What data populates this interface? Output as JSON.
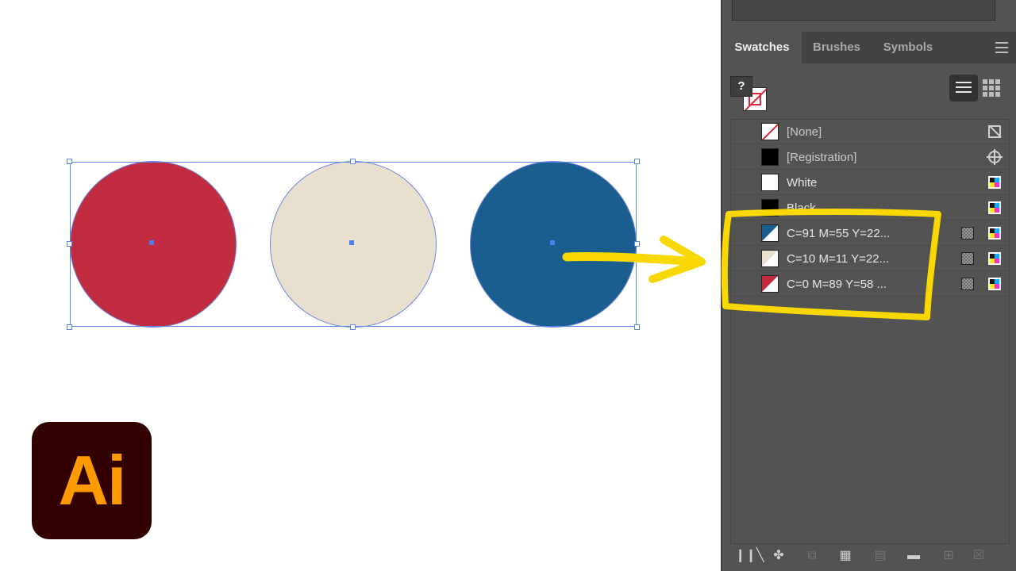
{
  "app": {
    "logo_text": "Ai",
    "logo_bg": "#330000",
    "logo_fg": "#ff9a00"
  },
  "canvas": {
    "shapes": [
      {
        "name": "red-circle",
        "color": "#c12c41"
      },
      {
        "name": "beige-circle",
        "color": "#e9dfcf"
      },
      {
        "name": "blue-circle",
        "color": "#1a5d8f"
      }
    ],
    "annotation_color": "#f8d800"
  },
  "panel": {
    "tabs": [
      {
        "label": "Swatches",
        "active": true
      },
      {
        "label": "Brushes",
        "active": false
      },
      {
        "label": "Symbols",
        "active": false
      }
    ],
    "fill_stroke": {
      "question_mark": "?"
    },
    "swatches": [
      {
        "name": "[None]",
        "type": "none",
        "mode": "nocolor"
      },
      {
        "name": "[Registration]",
        "type": "registration",
        "color": "#000000",
        "mode": "registration"
      },
      {
        "name": "White",
        "type": "process",
        "color": "#ffffff",
        "mode": "cmyk"
      },
      {
        "name": "Black",
        "type": "process",
        "color": "#000000",
        "mode": "cmyk"
      },
      {
        "name": "C=91 M=55 Y=22...",
        "type": "global",
        "color": "#1a5d8f",
        "mode": "cmyk"
      },
      {
        "name": "C=10 M=11 Y=22...",
        "type": "global",
        "color": "#e9dfcf",
        "mode": "cmyk"
      },
      {
        "name": "C=0 M=89 Y=58 ...",
        "type": "global",
        "color": "#c12c41",
        "mode": "cmyk"
      }
    ],
    "toolbar_icons": [
      "swatch-libraries-icon",
      "show-kinds-icon",
      "place-swatches-icon",
      "swatch-options-icon",
      "color-group-icon",
      "new-color-group-icon",
      "new-swatch-icon",
      "delete-swatch-icon"
    ]
  }
}
